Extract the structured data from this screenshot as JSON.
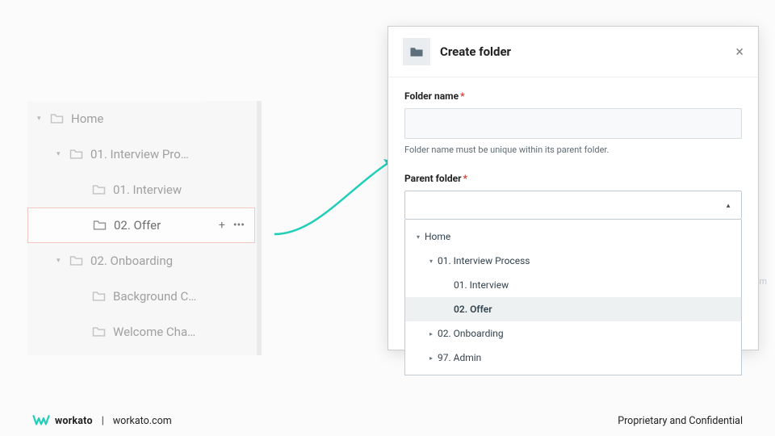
{
  "tree": {
    "items": [
      {
        "label": "Home",
        "indent": 0,
        "expanded": true
      },
      {
        "label": "01. Interview Pro…",
        "indent": 1,
        "expanded": true
      },
      {
        "label": "01. Interview",
        "indent": 2
      },
      {
        "label": "02. Offer",
        "indent": 2,
        "selected": true,
        "actions": true
      },
      {
        "label": "02. Onboarding",
        "indent": 1,
        "expanded": true
      },
      {
        "label": "Background C…",
        "indent": 2
      },
      {
        "label": "Welcome Cha…",
        "indent": 2
      }
    ]
  },
  "modal": {
    "title": "Create folder",
    "folder_name_label": "Folder name",
    "folder_name_value": "",
    "folder_name_hint": "Folder name must be unique within its parent folder.",
    "parent_label": "Parent folder",
    "dropdown_selected_text": "",
    "dropdown": [
      {
        "label": "Home",
        "indent": 0,
        "exp": "down"
      },
      {
        "label": "01. Interview Process",
        "indent": 1,
        "exp": "down"
      },
      {
        "label": "01. Interview",
        "indent": 2
      },
      {
        "label": "02. Offer",
        "indent": 2,
        "selected": true
      },
      {
        "label": "02. Onboarding",
        "indent": 1,
        "exp": "right"
      },
      {
        "label": "97. Admin",
        "indent": 1,
        "exp": "right"
      }
    ]
  },
  "footer": {
    "brand": "workato",
    "site": "workato.com",
    "right": "Proprietary and Confidential"
  },
  "colors": {
    "teal": "#21cfb9",
    "selection_border": "#f0b5a7",
    "modal_dark": "#33434e"
  }
}
